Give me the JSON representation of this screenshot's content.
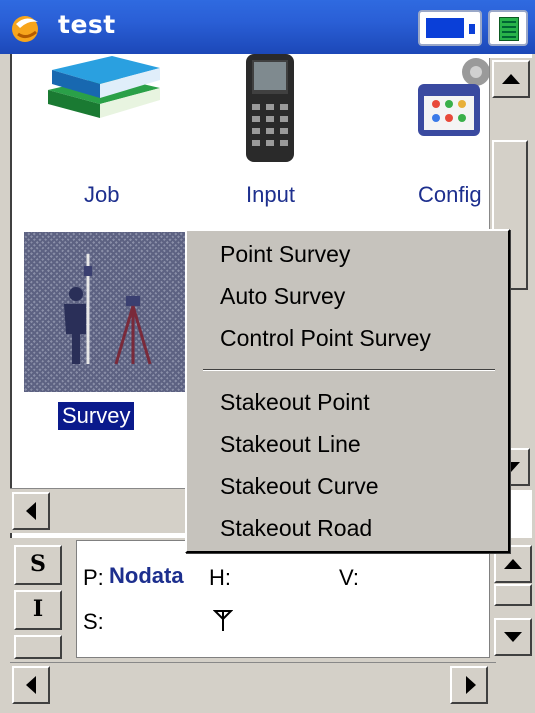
{
  "window": {
    "title": "test",
    "icons": [
      "app-logo-icon",
      "battery-icon",
      "keyboard-icon"
    ]
  },
  "launcher": {
    "items": [
      {
        "label": "Job",
        "icon": "books-icon"
      },
      {
        "label": "Input",
        "icon": "handheld-device-icon"
      },
      {
        "label": "Config",
        "icon": "config-gear-icon"
      },
      {
        "label": "Survey",
        "icon": "surveyor-icon",
        "selected": true
      }
    ]
  },
  "context_menu": {
    "group1": [
      "Point Survey",
      "Auto Survey",
      "Control Point Survey"
    ],
    "group2": [
      "Stakeout Point",
      "Stakeout Line",
      "Stakeout Curve",
      "Stakeout Road"
    ]
  },
  "status_panel": {
    "side_buttons": [
      "S",
      "I",
      ""
    ],
    "p_label": "P:",
    "p_value": "Nodata",
    "h_label": "H:",
    "v_label": "V:",
    "s_label": "S:",
    "antenna_icon": "antenna-icon"
  },
  "colors": {
    "title_bar": "#2a5fd6",
    "selection": "#0a1a8c",
    "label_text": "#1d2f8e"
  }
}
